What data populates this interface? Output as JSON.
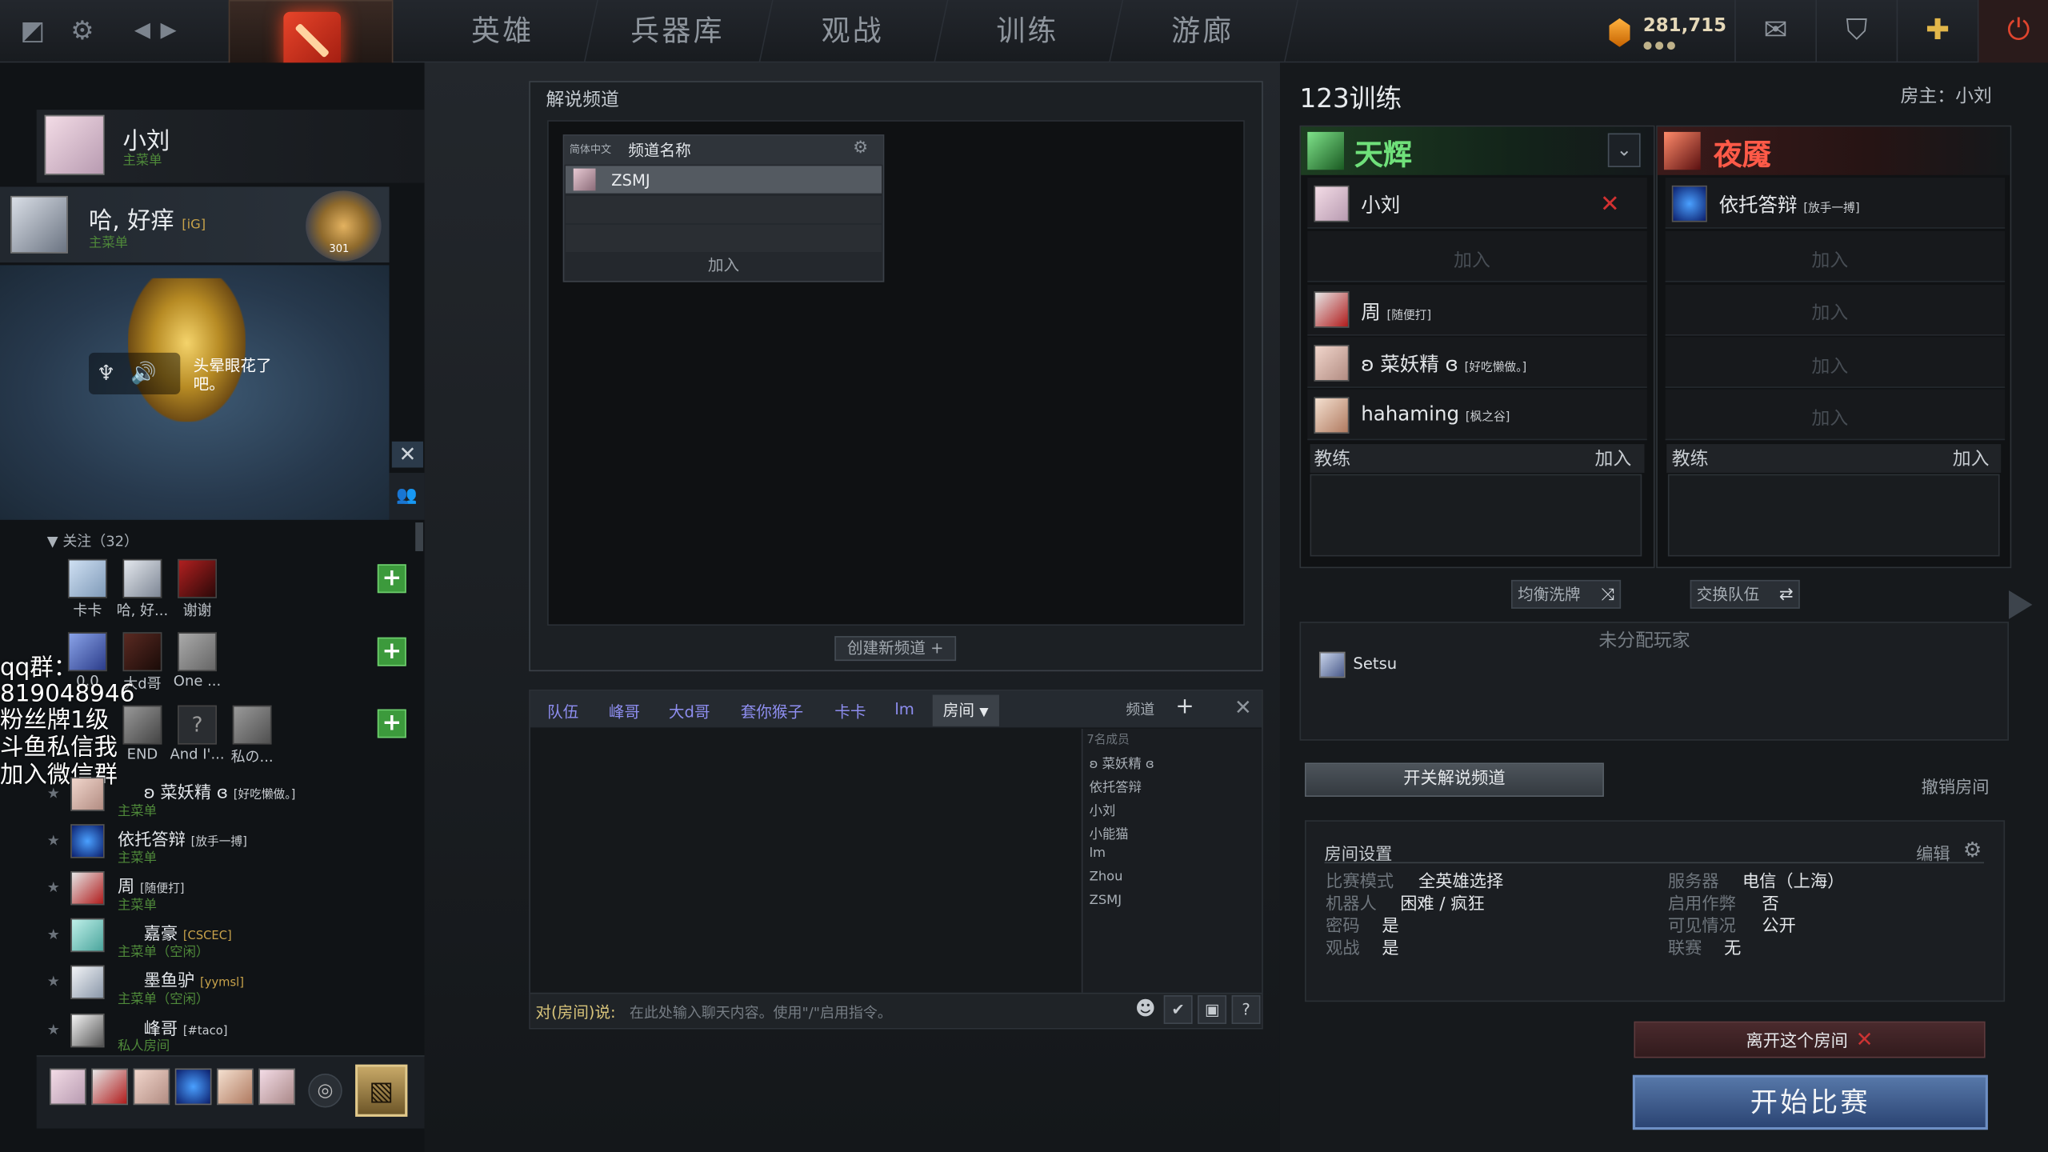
{
  "nav": {
    "tabs": [
      "英雄",
      "兵器库",
      "观战",
      "训练",
      "游廊"
    ],
    "currency": "281,715",
    "currency_dots": "●●●"
  },
  "left": {
    "me": {
      "name": "小刘",
      "status": "主菜单"
    },
    "party": {
      "name": "哈, 好痒",
      "tag": "[iG]",
      "status": "主菜单",
      "rank": "301"
    },
    "bubble": "头晕眼花了吧。",
    "follow_header": "关注（32）",
    "grid": [
      {
        "label": "卡卡"
      },
      {
        "label": "哈, 好..."
      },
      {
        "label": "谢谢"
      },
      {
        "label": "0.0"
      },
      {
        "label": "大d哥"
      },
      {
        "label": "One ..."
      },
      {
        "label": "END"
      },
      {
        "label": "And I'..."
      },
      {
        "label": "私の..."
      }
    ],
    "overlay": [
      "qq群：",
      "819048946",
      "粉丝牌1级",
      "斗鱼私信我",
      "加入微信群"
    ],
    "friends": [
      {
        "name": "ʚ 菜妖精 ɞ",
        "tag": "[好吃懒做。]",
        "status": "主菜单"
      },
      {
        "name": "依托答辩",
        "tag": "[放手一搏]",
        "status": "主菜单"
      },
      {
        "name": "周",
        "tag": "[随便打]",
        "status": "主菜单"
      },
      {
        "name": "嘉豪",
        "tag": "[CSCEC]",
        "status": "主菜单（空闲）"
      },
      {
        "name": "墨鱼驴",
        "tag": "[yymsl]",
        "status": "主菜单（空闲）"
      },
      {
        "name": "峰哥",
        "tag": "[#taco]",
        "status": "私人房间"
      }
    ]
  },
  "channel": {
    "title": "解说频道",
    "lang": "简体中文",
    "col": "频道名称",
    "rows": [
      "ZSMJ"
    ],
    "join": "加入",
    "create": "创建新频道"
  },
  "chat": {
    "tabs": [
      "队伍",
      "峰哥",
      "大d哥",
      "套你猴子",
      "卡卡",
      "lm",
      "房间"
    ],
    "channel_label": "频道",
    "member_header": "7名成员",
    "members": [
      "ʚ 菜妖精 ɞ",
      "依托答辩",
      "小刘",
      "小能猫",
      "lm",
      "Zhou",
      "ZSMJ"
    ],
    "input_label": "对(房间)说:",
    "input_placeholder": "在此处输入聊天内容。使用\"/\"启用指令。"
  },
  "lobby": {
    "title": "123训练",
    "host": "房主：小刘",
    "radiant": {
      "name": "天辉",
      "color": "#5ee06a",
      "slots": [
        {
          "name": "小刘",
          "tag": ""
        },
        {
          "name": "",
          "tag": "",
          "join": "加入"
        },
        {
          "name": "周",
          "tag": "[随便打]"
        },
        {
          "name": "ʚ 菜妖精 ɞ",
          "tag": "[好吃懒做。]"
        },
        {
          "name": "hahaming",
          "tag": "[枫之谷]"
        }
      ]
    },
    "dire": {
      "name": "夜魇",
      "color": "#ff4a3c",
      "slots": [
        {
          "name": "依托答辩",
          "tag": "[放手一搏]"
        },
        {
          "name": "",
          "join": "加入"
        },
        {
          "name": "",
          "join": "加入"
        },
        {
          "name": "",
          "join": "加入"
        },
        {
          "name": "",
          "join": "加入"
        }
      ]
    },
    "coach": "教练",
    "coach_join": "加入",
    "balance": "均衡洗牌",
    "swap": "交换队伍",
    "unassigned_title": "未分配玩家",
    "unassigned": [
      "Setsu"
    ],
    "broadcast_btn": "开关解说频道",
    "cancel_room": "撤销房间",
    "settings": {
      "title": "房间设置",
      "edit": "编辑",
      "left": [
        {
          "k": "比赛模式",
          "v": "全英雄选择"
        },
        {
          "k": "机器人",
          "v": "困难 / 疯狂"
        },
        {
          "k": "密码",
          "v": "是"
        },
        {
          "k": "观战",
          "v": "是"
        }
      ],
      "right": [
        {
          "k": "服务器",
          "v": "电信（上海）"
        },
        {
          "k": "启用作弊",
          "v": "否"
        },
        {
          "k": "可见情况",
          "v": "公开"
        },
        {
          "k": "联赛",
          "v": "无"
        }
      ]
    },
    "leave": "离开这个房间",
    "start": "开始比赛"
  }
}
